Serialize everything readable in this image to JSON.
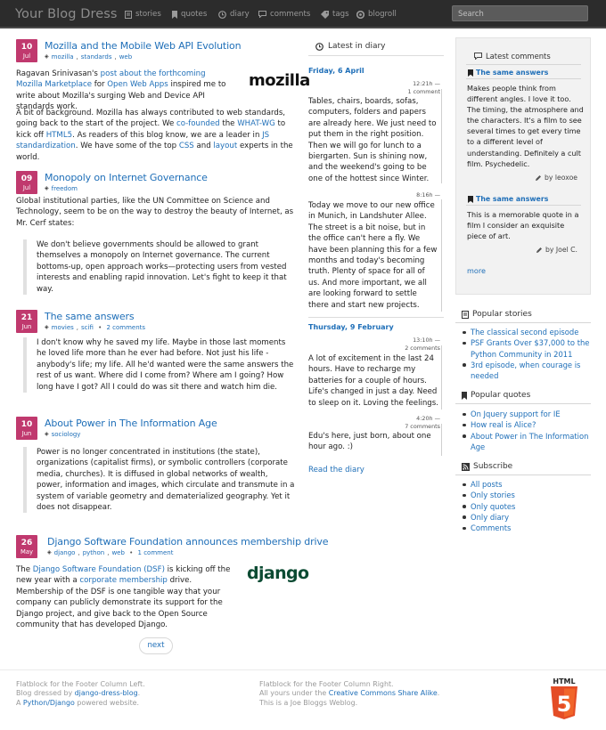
{
  "brand": "Your Blog Dress",
  "nav": {
    "stories": "stories",
    "quotes": "quotes",
    "diary": "diary",
    "comments": "comments",
    "tags": "tags",
    "blogroll": "blogroll"
  },
  "search": {
    "placeholder": "Search"
  },
  "posts": [
    {
      "day": "10",
      "month": "Jul",
      "title": "Mozilla and the Mobile Web API Evolution",
      "tags": [
        "mozilla",
        "standards",
        "web"
      ],
      "logo": "mozilla",
      "p1_a": "Ragavan Srinivasan's ",
      "p1_link1": "post about the forthcoming Mozilla Marketplace",
      "p1_b": " for ",
      "p1_link2": "Open Web Apps",
      "p1_c": " inspired me to write about Mozilla's surging Web and Device API standards work.",
      "p2_a": "A bit of background. Mozilla has always contributed to web standards, going back to the start of the project. We ",
      "p2_link1": "co-founded",
      "p2_b": " the ",
      "p2_link2": "WHAT-WG",
      "p2_c": " to kick off ",
      "p2_link3": "HTML5",
      "p2_d": ". As readers of this blog know, we are a leader in ",
      "p2_link4": "JS standardization",
      "p2_e": ". We have some of the top ",
      "p2_link5": "CSS",
      "p2_f": " and ",
      "p2_link6": "layout",
      "p2_g": " experts in the world."
    },
    {
      "day": "09",
      "month": "Jul",
      "title": "Monopoly on Internet Governance",
      "tags": [
        "freedom"
      ],
      "p1": "Global institutional parties, like the UN Committee on Science and Technology, seem to be on the way to destroy the beauty of Internet, as Mr. Cerf states:",
      "quote": "We don't believe governments should be allowed to grant themselves a monopoly on Internet governance. The current bottoms-up, open approach works—protecting users from vested interests and enabling rapid innovation. Let's fight to keep it that way."
    },
    {
      "day": "21",
      "month": "Jun",
      "title": "The same answers",
      "tags": [
        "movies",
        "scifi"
      ],
      "comments": "2 comments",
      "quote": "I don't know why he saved my life. Maybe in those last moments he loved life more than he ever had before. Not just his life - anybody's life; my life. All he'd wanted were the same answers the rest of us want. Where did I come from? Where am I going? How long have I got? All I could do was sit there and watch him die."
    },
    {
      "day": "10",
      "month": "Jun",
      "title": "About Power in The Information Age",
      "tags": [
        "sociology"
      ],
      "quote": "Power is no longer concentrated in institutions (the state), organizations (capitalist firms), or symbolic controllers (corporate media, churches). It is diffused in global networks of wealth, power, information and images, which circulate and transmute in a system of variable geometry and dematerialized geography. Yet it does not disappear."
    },
    {
      "day": "26",
      "month": "May",
      "title": "Django Software Foundation announces membership drive",
      "tags": [
        "django",
        "python",
        "web"
      ],
      "comments": "1 comment",
      "logo": "django",
      "p1_a": "The ",
      "p1_link1": "Django Software Foundation (DSF)",
      "p1_b": " is kicking off the new year with a ",
      "p1_link2": "corporate membership",
      "p1_c": " drive. Membership of the DSF is one tangible way that your company can publicly demonstrate its support for the Django project, and give back to the Open Source community that has developed Django."
    }
  ],
  "next_label": "next",
  "diary": {
    "heading": "Latest in diary",
    "day1": "Friday, 6 April",
    "day2": "Thursday, 9 February",
    "entries": [
      {
        "time": "12:21h",
        "comments": "1 comment",
        "text": "Tables, chairs, boards, sofas, computers, folders and papers are already here. We just need to put them in the right position. Then we will go for lunch to a biergarten. Sun is shining now, and the weekend's going to be one of the hottest since Winter."
      },
      {
        "time": "8:16h",
        "comments": "",
        "text": "Today we move to our new office in Munich, in Landshuter Allee. The street is a bit noise, but in the office can't here a fly. We have been planning this for a few months and today's becoming truth. Plenty of space for all of us. And more important, we all are looking forward to settle there and start new projects."
      },
      {
        "time": "13:10h",
        "comments": "2 comments",
        "text": "A lot of excitement in the last 24 hours. Have to recharge my batteries for a couple of hours. Life's changed in just a day. Need to sleep on it. Loving the feelings."
      },
      {
        "time": "4:20h",
        "comments": "7 comments",
        "text": "Edu's here, just born, about one hour ago. :)"
      }
    ],
    "read_more": "Read the diary"
  },
  "latest_comments": {
    "heading": "Latest comments",
    "items": [
      {
        "title": "The same answers",
        "text": "Makes people think from different angles. I love it too. The timing, the atmosphere and the characters. It's a film to see several times to get every time to a different level of understanding. Definitely a cult film. Psychedelic.",
        "by": "by leoxoe"
      },
      {
        "title": "The same answers",
        "text": "This is a memorable quote in a film I consider an exquisite piece of art.",
        "by": "by Joel C."
      }
    ],
    "more": "more"
  },
  "popular_stories": {
    "heading": "Popular stories",
    "items": [
      "The classical second episode",
      "PSF Grants Over $37,000 to the Python Community in 2011",
      "3rd episode, when courage is needed"
    ]
  },
  "popular_quotes": {
    "heading": "Popular quotes",
    "items": [
      "On Jquery support for IE",
      "How real is Alice?",
      "About Power in The Information Age"
    ]
  },
  "subscribe": {
    "heading": "Subscribe",
    "items": [
      "All posts",
      "Only stories",
      "Only quotes",
      "Only diary",
      "Comments"
    ]
  },
  "footer": {
    "left1": "Flatblock for the Footer Column Left.",
    "left2a": "Blog dressed by ",
    "left2link": "django-dress-blog",
    "left2b": ".",
    "left3a": "A ",
    "left3link": "Python/Django",
    "left3b": " powered website.",
    "right1": "Flatblock for the Footer Column Right.",
    "right2a": "All yours under the ",
    "right2link": "Creative Commons Share Alike",
    "right2b": ".",
    "right3": "This is a Joe Bloggs Weblog.",
    "badge": "HTML",
    "badge_num": "5"
  },
  "colors": {
    "accent": "#c0396e",
    "link": "#1f6fb8",
    "topbar": "#2c2c2c"
  },
  "icons": [
    "document-icon",
    "bookmark-icon",
    "clock-icon",
    "comment-icon",
    "tag-icon",
    "circle-icon",
    "rss-icon",
    "pencil-icon",
    "html5-icon"
  ]
}
